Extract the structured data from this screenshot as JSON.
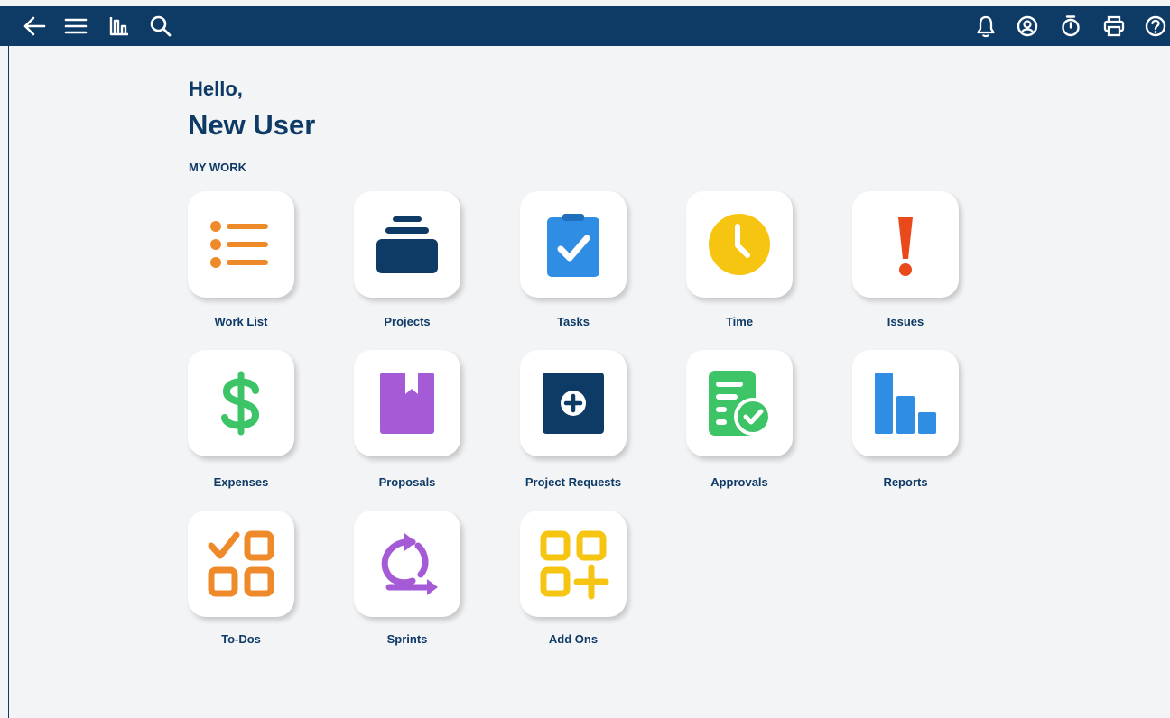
{
  "greeting": {
    "hello": "Hello,",
    "name": "New User"
  },
  "section_title": "MY WORK",
  "topbar": {
    "left_icons": [
      "back-arrow-icon",
      "hamburger-menu-icon",
      "dashboard-icon",
      "search-icon"
    ],
    "right_icons": [
      "bell-icon",
      "account-icon",
      "stopwatch-icon",
      "print-icon",
      "help-icon"
    ]
  },
  "tiles": [
    {
      "label": "Work List",
      "icon": "work-list-icon"
    },
    {
      "label": "Projects",
      "icon": "projects-icon"
    },
    {
      "label": "Tasks",
      "icon": "tasks-icon"
    },
    {
      "label": "Time",
      "icon": "clock-icon"
    },
    {
      "label": "Issues",
      "icon": "exclamation-icon"
    },
    {
      "label": "Expenses",
      "icon": "dollar-icon"
    },
    {
      "label": "Proposals",
      "icon": "proposal-book-icon"
    },
    {
      "label": "Project Requests",
      "icon": "add-request-icon"
    },
    {
      "label": "Approvals",
      "icon": "approval-doc-icon"
    },
    {
      "label": "Reports",
      "icon": "bar-chart-icon"
    },
    {
      "label": "To-Dos",
      "icon": "todo-grid-icon"
    },
    {
      "label": "Sprints",
      "icon": "sprint-cycle-icon"
    },
    {
      "label": "Add Ons",
      "icon": "add-ons-grid-icon"
    }
  ],
  "colors": {
    "topbar": "#0e3a66",
    "work_list": "#ef8a2b",
    "projects": "#0e3a66",
    "tasks": "#2f8de4",
    "time": "#f6c512",
    "issues": "#e84a1c",
    "expenses": "#3cc467",
    "proposals": "#a55ad6",
    "approvals": "#3cc467",
    "reports": "#2f8de4",
    "sprints": "#a55ad6",
    "add_ons": "#f6c512"
  }
}
